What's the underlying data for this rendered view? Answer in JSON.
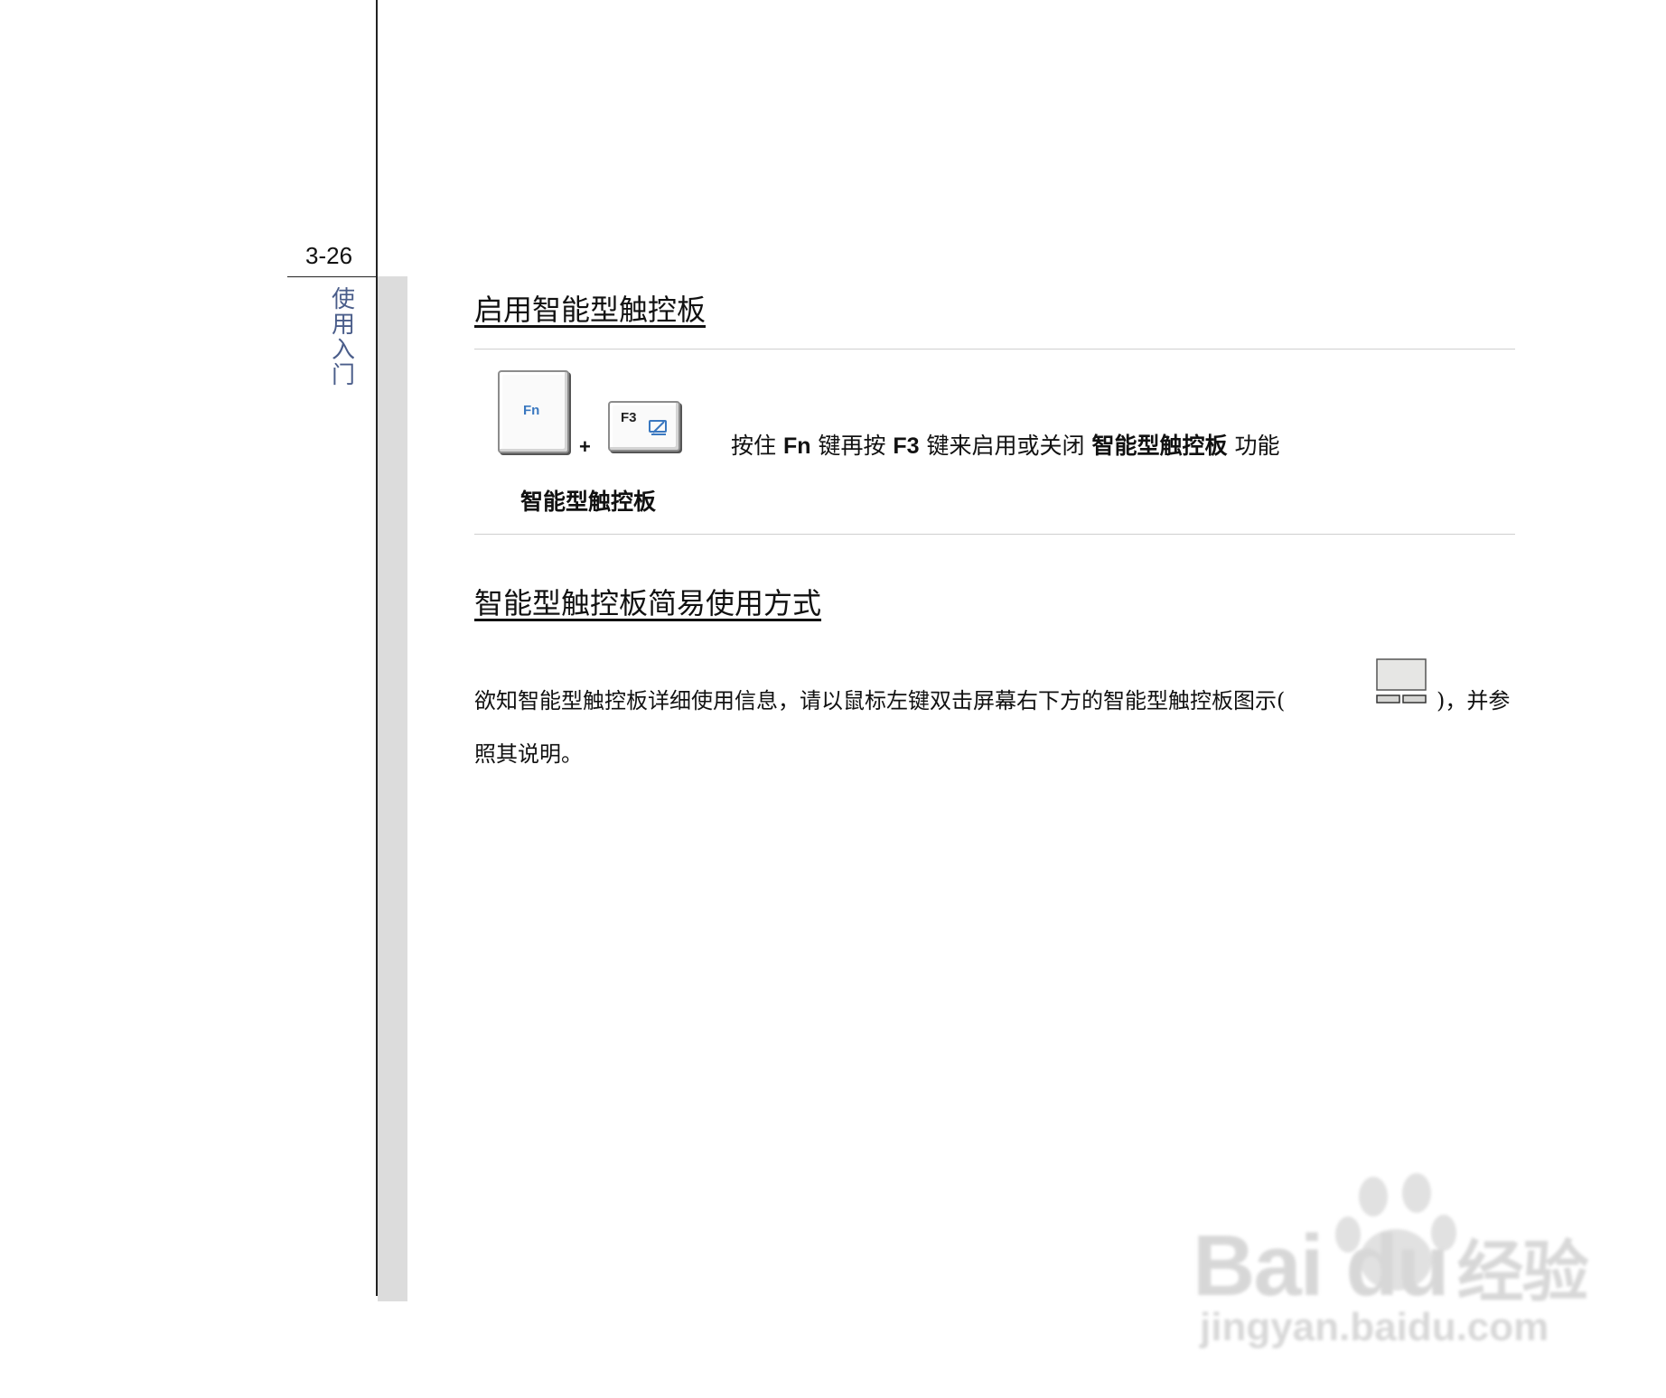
{
  "page": {
    "number": "3-26",
    "chapter_title": "使用入门",
    "chapter_chars": [
      "使",
      "用",
      "入",
      "门"
    ]
  },
  "section1": {
    "heading": "启用智能型触控板",
    "key1_label": "Fn",
    "key2_label": "F3",
    "plus": "+",
    "caption": "智能型触控板",
    "instruction": {
      "p1": "按住 ",
      "k1": "Fn",
      "p2": " 键再按 ",
      "k2": "F3",
      "p3": " 键来启用或关闭",
      "bold": "智能型触控板",
      "p4": "功能"
    }
  },
  "section2": {
    "heading": "智能型触控板简易使用方式",
    "line1_before": "欲知智能型触控板详细使用信息，请以鼠标左键双击屏幕右下方的智能型触控板图示(",
    "line1_after": ")，并参",
    "line2": "照其说明。"
  },
  "watermark": {
    "line1_brand": "Bai",
    "line1_brand2": "du",
    "line1_cn": "经验",
    "line2": "jingyan.baidu.com"
  },
  "colors": {
    "chapter_text": "#4a5d8a",
    "key_legend": "#3a78c0",
    "side_strip": "#dcdcdc"
  },
  "icons": [
    "touchpad-toggle-icon",
    "touchpad-tray-icon",
    "baidu-paw-icon"
  ]
}
